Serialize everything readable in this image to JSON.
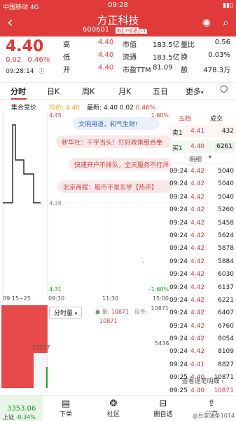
{
  "status_bar": {
    "carrier": "中国移动 4G",
    "time": "09:28",
    "battery": ""
  },
  "header": {
    "back_icon": "chevron-left-icon",
    "stock_name": "方正科技",
    "stock_code": "600601",
    "tags": [
      "融",
      "沪股通",
      "L1"
    ]
  },
  "quote": {
    "price": "4.40",
    "change": "0.02",
    "change_pct": "0.46%",
    "time": "09:28:14",
    "fields": [
      {
        "label": "高",
        "value": "4.40",
        "label2": "市值",
        "value2": "183.5亿",
        "label3": "量比",
        "value3": "0.56"
      },
      {
        "label": "低",
        "value": "4.40",
        "label2": "流通",
        "value2": "183.5亿",
        "label3": "换",
        "value3": "0.03%"
      },
      {
        "label": "开",
        "value": "4.40",
        "label2": "市盈TTM",
        "value2": "81.09",
        "label3": "额",
        "value3": "478.3万"
      }
    ]
  },
  "tabs": [
    "分时",
    "日K",
    "周K",
    "月K",
    "五日",
    "更多"
  ],
  "legend": {
    "auction": "集合竞价",
    "avg_label": "均价:",
    "avg": "4.40",
    "latest_label": "最新:",
    "latest": "4.40",
    "chg": "0.02",
    "pct": "0.46%"
  },
  "chart": {
    "y_high": "4.45",
    "y_mid": "4.38",
    "y_low": "4.31",
    "pct_high": "1.60%",
    "pct_low": "-1.60%",
    "x_labels": [
      "09:15~25",
      "09:30",
      "11:30",
      "15:00"
    ]
  },
  "danmu": [
    "文明用语，和气生财!",
    "新华社：干字当头！打好政策组合拳",
    "快速开户不排队，全天服务不打烊",
    "北京商报：股市不是玄学【热评】"
  ],
  "order_book": {
    "tab1": "五档",
    "tab2": "成交",
    "sell_label": "卖1",
    "sell_price": "4.41",
    "sell_vol": "432",
    "buy_label": "买1",
    "buy_price": "4.40",
    "buy_vol": "6261",
    "detail_label": "明细"
  },
  "trades": [
    {
      "time": "09:24",
      "price": "4.42",
      "vol": "5040"
    },
    {
      "time": "09:24",
      "price": "4.42",
      "vol": "5040"
    },
    {
      "time": "09:24",
      "price": "4.42",
      "vol": "5040"
    },
    {
      "time": "09:24",
      "price": "4.42",
      "vol": "5260"
    },
    {
      "time": "09:24",
      "price": "4.42",
      "vol": "5458"
    },
    {
      "time": "09:24",
      "price": "4.42",
      "vol": "5624"
    },
    {
      "time": "09:24",
      "price": "4.42",
      "vol": "5878"
    },
    {
      "time": "09:24",
      "price": "4.42",
      "vol": "5884"
    },
    {
      "time": "09:24",
      "price": "4.42",
      "vol": "6030"
    },
    {
      "time": "09:24",
      "price": "4.42",
      "vol": "6137"
    },
    {
      "time": "09:24",
      "price": "4.42",
      "vol": "6221"
    },
    {
      "time": "09:24",
      "price": "4.42",
      "vol": "6407"
    },
    {
      "time": "09:24",
      "price": "4.42",
      "vol": "6760"
    },
    {
      "time": "09:24",
      "price": "4.42",
      "vol": "8054"
    },
    {
      "time": "09:24",
      "price": "4.42",
      "vol": "8109"
    },
    {
      "time": "09:24",
      "price": "4.41",
      "vol": "8827"
    },
    {
      "time": "09:25",
      "price": "4.40",
      "vol": "10871"
    },
    {
      "time": "09:25",
      "price": "4.40",
      "vol": "10871"
    }
  ],
  "trade_footer": "查看逐笔明细",
  "volume": {
    "selector": "分时量",
    "qty_label": "量:",
    "qty": "10871",
    "hand_label": "现手:",
    "hand": "10871",
    "mid_left": "12237",
    "mid_right": "5436",
    "right_top": "10871"
  },
  "bottom_bar": {
    "index_value": "3353.06",
    "index_name": "上证",
    "index_chg": "-0.34%",
    "items": [
      "下单",
      "社区",
      "删自选",
      "分享"
    ],
    "watermark": "@豆浆油条1014"
  }
}
